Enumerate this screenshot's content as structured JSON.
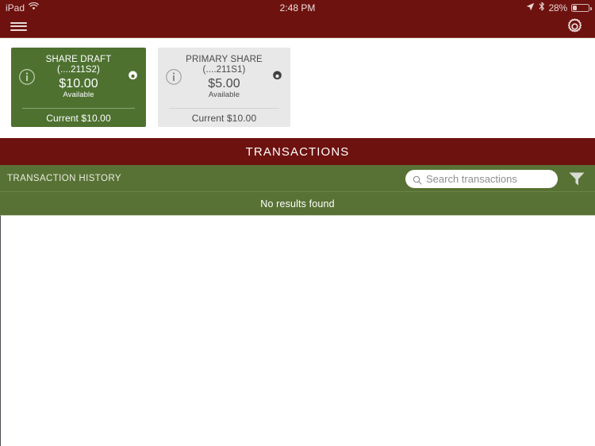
{
  "status_bar": {
    "device": "iPad",
    "wifi_icon": "wifi-icon",
    "time": "2:48 PM",
    "location_icon": "location-arrow-icon",
    "bluetooth_icon": "bluetooth-icon",
    "battery_percent": "28%",
    "battery_icon": "battery-icon"
  },
  "nav_bar": {
    "menu_icon": "hamburger-menu-icon",
    "settings_icon": "gear-icon",
    "background_color": "#6d120f"
  },
  "accounts": [
    {
      "name": "SHARE DRAFT",
      "mask": "(....211S2)",
      "available_amount": "$10.00",
      "available_label": "Available",
      "current_label": "Current $10.00",
      "info_icon": "info-circle-icon",
      "settings_icon": "gear-icon",
      "selected": true,
      "background_color": "#4e7130",
      "text_color": "#ffffff"
    },
    {
      "name": "PRIMARY SHARE",
      "mask": "(....211S1)",
      "available_amount": "$5.00",
      "available_label": "Available",
      "current_label": "Current $10.00",
      "info_icon": "info-circle-icon",
      "settings_icon": "gear-icon",
      "selected": false,
      "background_color": "#e8e8e8",
      "text_color": "#4a4a4a"
    }
  ],
  "transactions_section": {
    "title": "TRANSACTIONS",
    "title_background_color": "#6d120f",
    "history_label": "TRANSACTION HISTORY",
    "history_background_color": "#587235",
    "search": {
      "placeholder": "Search transactions",
      "value": "",
      "icon": "search-icon"
    },
    "filter_icon": "filter-funnel-icon",
    "empty_state": "No results found"
  }
}
